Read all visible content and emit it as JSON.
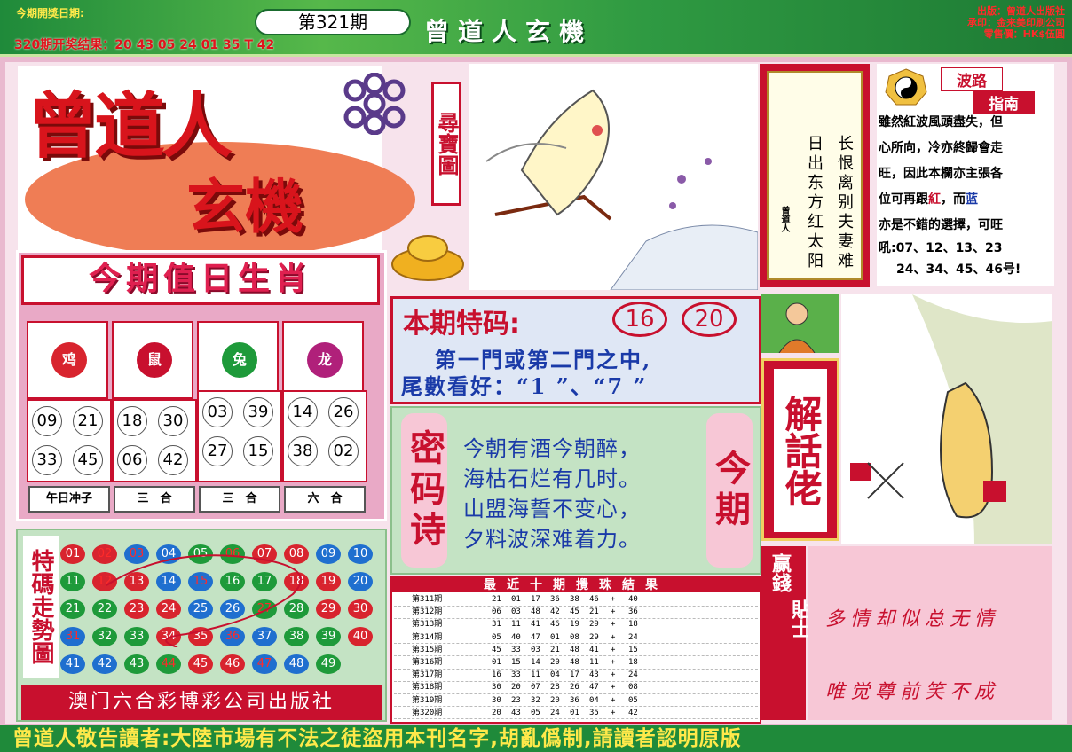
{
  "header": {
    "open_date_label": "今期開獎日期:",
    "prev_result": "320期开奖结果：20 43 05 24 01 35 T 42",
    "issue": "第321期",
    "banner_title": "曾道人玄機",
    "publisher_lines": [
      "出版：曾道人出版社",
      "承印：金来美印刷公司",
      "零售價：HK$伍圓"
    ]
  },
  "logo": {
    "main": "曾道人",
    "sub": "玄機",
    "treasure_map": "尋寶圖"
  },
  "verse": {
    "col_right": "长恨离别夫妻难",
    "col_left": "日出东方红太阳",
    "seal": "曾道人"
  },
  "wave_guide": {
    "title_top": "波路",
    "title_bottom": "指南",
    "line1": "雖然紅波風頭盡失，但",
    "line2": "心所向，冷亦終歸會走",
    "line3": "旺，因此本欄亦主張各",
    "line4_a": "位可再跟",
    "line4_red": "紅",
    "line4_b": "，而",
    "line4_blue": "蓝",
    "line5": "亦是不錯的選擇，可旺",
    "line6": "吼:07、12、13、23",
    "line7": "24、34、45、46号!"
  },
  "zodiac": {
    "title": "今期值日生肖",
    "cards": [
      {
        "name": "鸡",
        "color": "#d8242e",
        "numbers": [
          "09",
          "21",
          "33",
          "45"
        ],
        "label": "午日冲子"
      },
      {
        "name": "鼠",
        "color": "#c8102e",
        "numbers": [
          "18",
          "30",
          "06",
          "42"
        ],
        "label": "三　合"
      },
      {
        "name": "兔",
        "color": "#1e9a3a",
        "numbers": [
          "03",
          "39",
          "27",
          "15"
        ],
        "label": "三　合"
      },
      {
        "name": "龙",
        "color": "#b0207a",
        "numbers": [
          "14",
          "26",
          "38",
          "02"
        ],
        "label": "六　合"
      }
    ]
  },
  "special": {
    "label": "本期特码:",
    "num1": "16",
    "num2": "20",
    "line1": "第一門或第二門之中,",
    "line2": "尾數看好：“1 ”、“7 ”"
  },
  "secret_poem": {
    "badge_left": "密码诗",
    "badge_right": "今期",
    "lines": [
      "今朝有酒今朝醉，",
      "海枯石烂有几时。",
      "山盟海誓不变心，",
      "夕料波深难着力。"
    ]
  },
  "trend": {
    "label": "特碼走勢圖",
    "publisher": "澳门六合彩博彩公司出版社",
    "rows": [
      [
        [
          "01",
          "r"
        ],
        [
          "02",
          "r"
        ],
        [
          "03",
          "b"
        ],
        [
          "04",
          "b"
        ],
        [
          "05",
          "g"
        ],
        [
          "06",
          "g"
        ],
        [
          "07",
          "r"
        ],
        [
          "08",
          "r"
        ],
        [
          "09",
          "b"
        ],
        [
          "10",
          "b"
        ]
      ],
      [
        [
          "11",
          "g"
        ],
        [
          "12",
          "r"
        ],
        [
          "13",
          "r"
        ],
        [
          "14",
          "b"
        ],
        [
          "15",
          "b"
        ],
        [
          "16",
          "g"
        ],
        [
          "17",
          "g"
        ],
        [
          "18",
          "r"
        ],
        [
          "19",
          "r"
        ],
        [
          "20",
          "b"
        ]
      ],
      [
        [
          "21",
          "g"
        ],
        [
          "22",
          "g"
        ],
        [
          "23",
          "r"
        ],
        [
          "24",
          "r"
        ],
        [
          "25",
          "b"
        ],
        [
          "26",
          "b"
        ],
        [
          "27",
          "g"
        ],
        [
          "28",
          "g"
        ],
        [
          "29",
          "r"
        ],
        [
          "30",
          "r"
        ]
      ],
      [
        [
          "31",
          "b"
        ],
        [
          "32",
          "g"
        ],
        [
          "33",
          "g"
        ],
        [
          "34",
          "r"
        ],
        [
          "35",
          "r"
        ],
        [
          "36",
          "b"
        ],
        [
          "37",
          "b"
        ],
        [
          "38",
          "g"
        ],
        [
          "39",
          "g"
        ],
        [
          "40",
          "r"
        ]
      ],
      [
        [
          "41",
          "b"
        ],
        [
          "42",
          "b"
        ],
        [
          "43",
          "g"
        ],
        [
          "44",
          "g"
        ],
        [
          "45",
          "r"
        ],
        [
          "46",
          "r"
        ],
        [
          "47",
          "b"
        ],
        [
          "48",
          "b"
        ],
        [
          "49",
          "g"
        ]
      ]
    ]
  },
  "explain": {
    "title": "解話佬"
  },
  "results": {
    "header": "最近十期攪珠結果",
    "rows": [
      [
        "第311期",
        "21",
        "01",
        "17",
        "36",
        "38",
        "46",
        "+",
        "40"
      ],
      [
        "第312期",
        "06",
        "03",
        "48",
        "42",
        "45",
        "21",
        "+",
        "36"
      ],
      [
        "第313期",
        "31",
        "11",
        "41",
        "46",
        "19",
        "29",
        "+",
        "18"
      ],
      [
        "第314期",
        "05",
        "40",
        "47",
        "01",
        "08",
        "29",
        "+",
        "24"
      ],
      [
        "第315期",
        "45",
        "33",
        "03",
        "21",
        "48",
        "41",
        "+",
        "15"
      ],
      [
        "第316期",
        "01",
        "15",
        "14",
        "20",
        "48",
        "11",
        "+",
        "18"
      ],
      [
        "第317期",
        "16",
        "33",
        "11",
        "04",
        "17",
        "43",
        "+",
        "24"
      ],
      [
        "第318期",
        "30",
        "20",
        "07",
        "28",
        "26",
        "47",
        "+",
        "08"
      ],
      [
        "第319期",
        "30",
        "23",
        "32",
        "20",
        "36",
        "04",
        "+",
        "05"
      ],
      [
        "第320期",
        "20",
        "43",
        "05",
        "24",
        "01",
        "35",
        "+",
        "42"
      ]
    ]
  },
  "tips": {
    "badge_a": "赢錢",
    "badge_b": "貼士",
    "line1": "多情却似总无情",
    "line2": "唯觉尊前笑不成"
  },
  "notice": "曾道人敬告讀者:大陸市場有不法之徒盜用本刊名字,胡亂僞制,請讀者認明原版"
}
